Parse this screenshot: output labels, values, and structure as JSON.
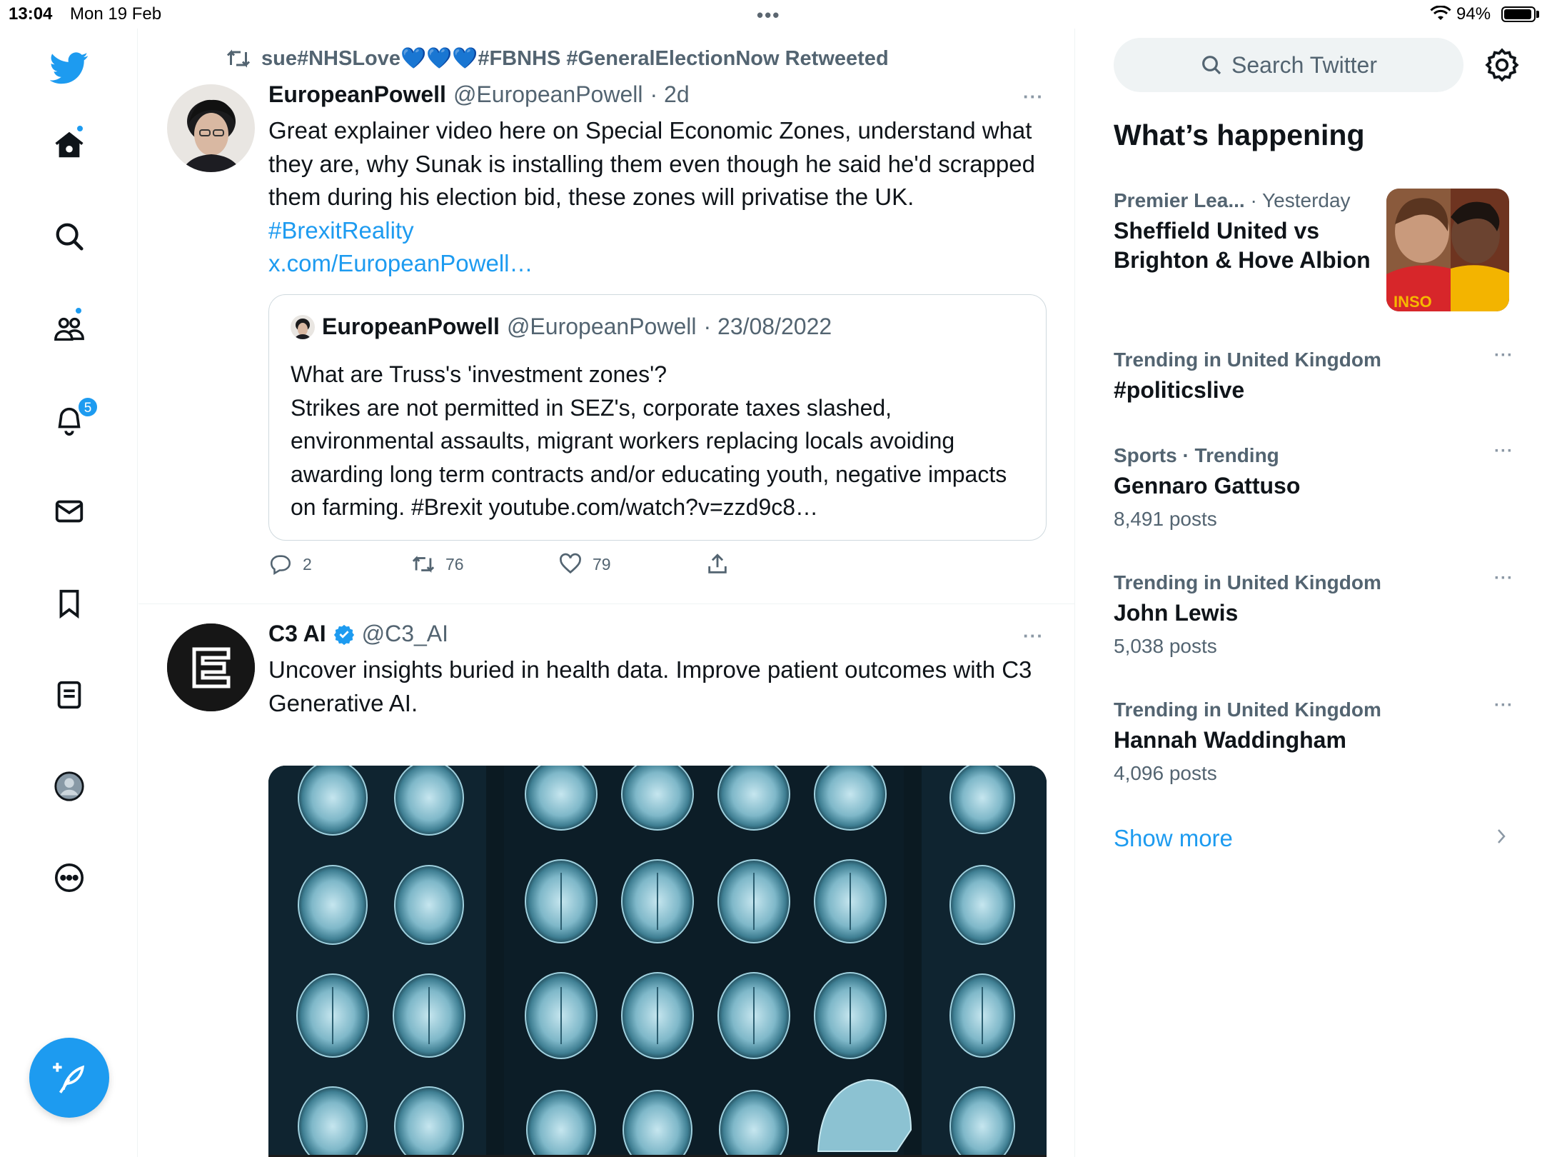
{
  "status_bar": {
    "time": "13:04",
    "date": "Mon 19 Feb",
    "battery": "94%",
    "battery_level": 0.94,
    "dots": "•••"
  },
  "nav": {
    "notifications_badge": "5"
  },
  "tweet1": {
    "retweeted_by": "sue#NHSLove💙💙💙#FBNHS #GeneralElectionNow Retweeted",
    "name": "EuropeanPowell",
    "handle": "@EuropeanPowell",
    "time": "· 2d",
    "more": "···",
    "text": "Great explainer video here on Special Economic Zones, understand what they are, why Sunak is installing them even though he said he'd scrapped them during his election bid, these zones will privatise the UK.",
    "hashtag": "#BrexitReality",
    "link": "x.com/EuropeanPowell…",
    "quote": {
      "name": "EuropeanPowell",
      "handle": "@EuropeanPowell",
      "time": "· 23/08/2022",
      "text_line1": "What are Truss's 'investment zones'?",
      "text_rest": "Strikes are not permitted in SEZ's, corporate taxes slashed, environmental assaults, migrant workers replacing locals avoiding awarding long term contracts and/or educating youth, negative impacts on farming. #Brexit youtube.com/watch?v=zzd9c8…"
    },
    "replies": "2",
    "retweets": "76",
    "likes": "79"
  },
  "tweet2": {
    "name": "C3 AI",
    "handle": "@C3_AI",
    "more": "···",
    "text": "Uncover insights buried in health data. Improve patient outcomes with C3 Generative AI."
  },
  "sidebar": {
    "search_placeholder": "Search Twitter",
    "title": "What’s happening",
    "trends": [
      {
        "meta": "Premier Lea...",
        "meta_time": "· Yesterday",
        "name": "Sheffield United vs Brighton & Hove Albion",
        "count": ""
      },
      {
        "meta": "Trending in United Kingdom",
        "name": "#politicslive",
        "count": ""
      },
      {
        "meta": "Sports · Trending",
        "name": "Gennaro Gattuso",
        "count": "8,491 posts"
      },
      {
        "meta": "Trending in United Kingdom",
        "name": "John Lewis",
        "count": "5,038 posts"
      },
      {
        "meta": "Trending in United Kingdom",
        "name": "Hannah Waddingham",
        "count": "4,096 posts"
      }
    ],
    "more": "···",
    "show_more": "Show more"
  },
  "colors": {
    "accent": "#1d9bf0",
    "text": "#0f1419",
    "secondary": "#536471",
    "border": "#eff3f4"
  }
}
